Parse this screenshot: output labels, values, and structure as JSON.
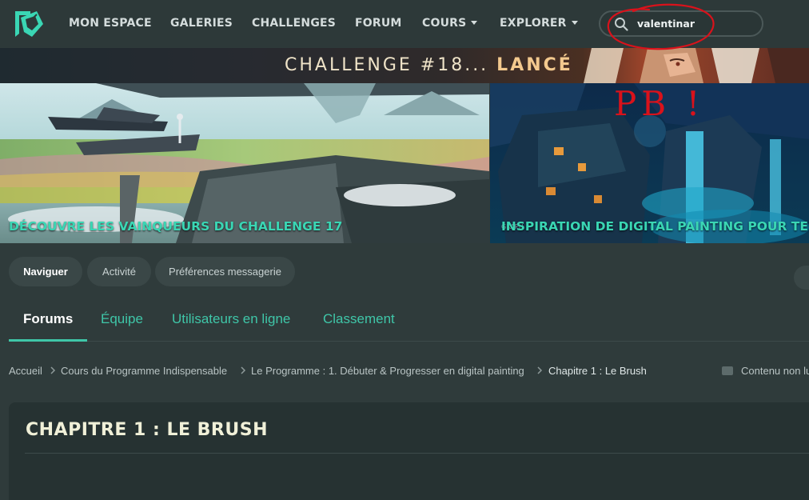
{
  "nav": {
    "items": [
      {
        "label": "MON ESPACE"
      },
      {
        "label": "GALERIES"
      },
      {
        "label": "CHALLENGES"
      },
      {
        "label": "FORUM"
      },
      {
        "label": "COURS"
      },
      {
        "label": "EXPLORER"
      }
    ],
    "search_value": "valentinar"
  },
  "annotation": {
    "text": "PB !",
    "color": "#d9121b"
  },
  "banner": {
    "prefix": "CHALLENGE #18... ",
    "highlight": "LANCÉ"
  },
  "cards": [
    {
      "title": "DÉCOUVRE LES VAINQUEURS DU CHALLENGE 17"
    },
    {
      "title": "INSPIRATION DE DIGITAL PAINTING POUR TES ILLUSTRATIONS"
    }
  ],
  "subnav": {
    "items": [
      {
        "label": "Naviguer"
      },
      {
        "label": "Activité"
      },
      {
        "label": "Préférences messagerie"
      }
    ]
  },
  "tabs": [
    {
      "label": "Forums"
    },
    {
      "label": "Équipe"
    },
    {
      "label": "Utilisateurs en ligne"
    },
    {
      "label": "Classement"
    }
  ],
  "breadcrumb": [
    {
      "label": "Accueil"
    },
    {
      "label": "Cours du Programme Indispensable"
    },
    {
      "label": "Le Programme : 1. Débuter & Progresser en digital painting"
    },
    {
      "label": "Chapitre 1 : Le Brush"
    }
  ],
  "unread_label": "Contenu non lu",
  "page_title": "CHAPITRE 1 : LE BRUSH",
  "colors": {
    "accent": "#3fc6a8",
    "background": "#2f3b3b",
    "nav": "#2d3939",
    "annotation": "#d9121b"
  }
}
